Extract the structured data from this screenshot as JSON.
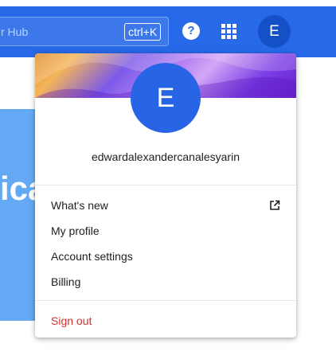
{
  "header": {
    "search_placeholder": "r Hub",
    "shortcut": "ctrl+K",
    "help_glyph": "?",
    "avatar_initial": "E"
  },
  "background": {
    "heading_fragment": "ica"
  },
  "account_menu": {
    "avatar_initial": "E",
    "username": "edwardalexandercanalesyarin",
    "items": [
      {
        "label": "What's new",
        "icon": "external-link-icon"
      },
      {
        "label": "My profile"
      },
      {
        "label": "Account settings"
      },
      {
        "label": "Billing"
      }
    ],
    "sign_out": "Sign out"
  },
  "colors": {
    "header": "#2769e8",
    "avatar": "#2765e6",
    "sign_out": "#d32f2f",
    "background_card": "#64a9f3"
  }
}
